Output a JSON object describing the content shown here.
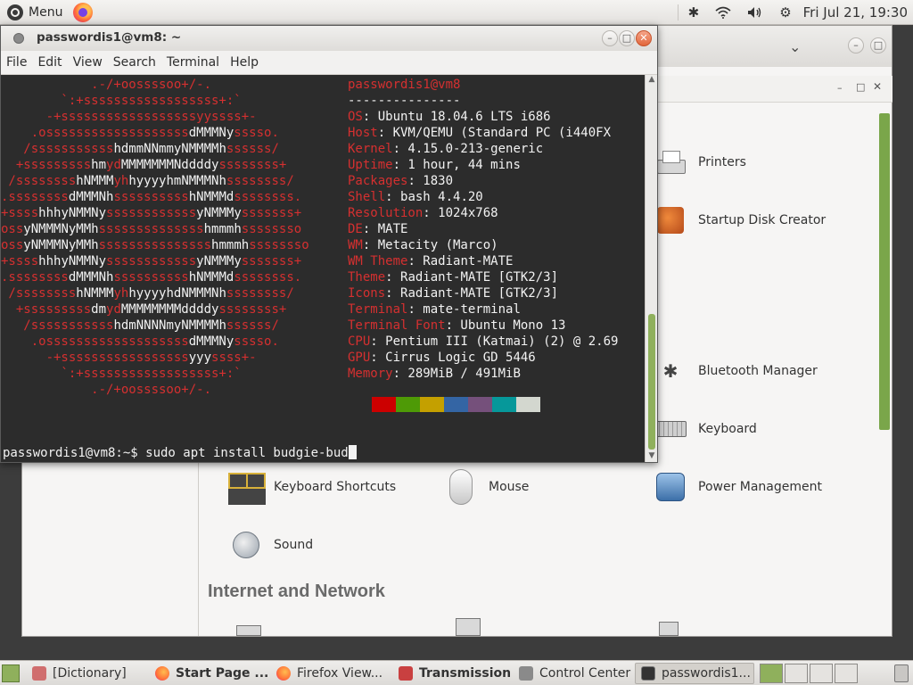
{
  "top_panel": {
    "menu_label": "Menu",
    "clock": "Fri Jul 21, 19:30",
    "tray_icons": [
      "bluetooth-icon",
      "wifi-icon",
      "volume-icon",
      "settings-icon"
    ]
  },
  "control_center": {
    "items": {
      "printers": "Printers",
      "startup_disk": "Startup Disk Creator",
      "bluetooth": "Bluetooth Manager",
      "keyboard": "Keyboard",
      "keyboard_shortcuts": "Keyboard Shortcuts",
      "mouse": "Mouse",
      "power": "Power Management",
      "sound": "Sound"
    },
    "section_internet": "Internet and Network"
  },
  "terminal": {
    "title": "passwordis1@vm8: ~",
    "menu": [
      "File",
      "Edit",
      "View",
      "Search",
      "Terminal",
      "Help"
    ],
    "info": {
      "user_host": "passwordis1@vm8",
      "rule": "---------------",
      "rows": [
        {
          "k": "OS",
          "v": ": Ubuntu 18.04.6 LTS i686"
        },
        {
          "k": "Host",
          "v": ": KVM/QEMU (Standard PC (i440FX"
        },
        {
          "k": "Kernel",
          "v": ": 4.15.0-213-generic"
        },
        {
          "k": "Uptime",
          "v": ": 1 hour, 44 mins"
        },
        {
          "k": "Packages",
          "v": ": 1830"
        },
        {
          "k": "Shell",
          "v": ": bash 4.4.20"
        },
        {
          "k": "Resolution",
          "v": ": 1024x768"
        },
        {
          "k": "DE",
          "v": ": MATE"
        },
        {
          "k": "WM",
          "v": ": Metacity (Marco)"
        },
        {
          "k": "WM Theme",
          "v": ": Radiant-MATE"
        },
        {
          "k": "Theme",
          "v": ": Radiant-MATE [GTK2/3]"
        },
        {
          "k": "Icons",
          "v": ": Radiant-MATE [GTK2/3]"
        },
        {
          "k": "Terminal",
          "v": ": mate-terminal"
        },
        {
          "k": "Terminal Font",
          "v": ": Ubuntu Mono 13"
        },
        {
          "k": "CPU",
          "v": ": Pentium III (Katmai) (2) @ 2.69"
        },
        {
          "k": "GPU",
          "v": ": Cirrus Logic GD 5446"
        },
        {
          "k": "Memory",
          "v": ": 289MiB / 491MiB"
        }
      ]
    },
    "logo": [
      [
        [
          "r",
          "            .-/+oossssoo+/-."
        ]
      ],
      [
        [
          "r",
          "        `:+ssssssssssssssssss+:`"
        ]
      ],
      [
        [
          "r",
          "      -+ssssssssssssssssssyyssss+-"
        ]
      ],
      [
        [
          "r",
          "    .osssssssssssssssssss"
        ],
        [
          "w",
          "dMMMNy"
        ],
        [
          "r",
          "sssso."
        ]
      ],
      [
        [
          "r",
          "   /sssssssssss"
        ],
        [
          "w",
          "hdmmNNmmyNMMMMh"
        ],
        [
          "r",
          "ssssss/"
        ]
      ],
      [
        [
          "r",
          "  +sssssssss"
        ],
        [
          "w",
          "hm"
        ],
        [
          "r",
          "yd"
        ],
        [
          "w",
          "MMMMMMMNddddy"
        ],
        [
          "r",
          "ssssssss+"
        ]
      ],
      [
        [
          "r",
          " /ssssssss"
        ],
        [
          "w",
          "hNMMM"
        ],
        [
          "r",
          "yh"
        ],
        [
          "w",
          "hyyyyhmNMMMNh"
        ],
        [
          "r",
          "ssssssss/"
        ]
      ],
      [
        [
          "r",
          ".ssssssss"
        ],
        [
          "w",
          "dMMMNh"
        ],
        [
          "r",
          "ssssssssss"
        ],
        [
          "w",
          "hNMMMd"
        ],
        [
          "r",
          "ssssssss."
        ]
      ],
      [
        [
          "r",
          "+ssss"
        ],
        [
          "w",
          "hhhyNMMNy"
        ],
        [
          "r",
          "ssssssssssss"
        ],
        [
          "w",
          "yNMMMy"
        ],
        [
          "r",
          "sssssss+"
        ]
      ],
      [
        [
          "r",
          "oss"
        ],
        [
          "w",
          "yNMMMNyMMh"
        ],
        [
          "r",
          "ssssssssssssss"
        ],
        [
          "w",
          "hmmmh"
        ],
        [
          "r",
          "ssssssso"
        ]
      ],
      [
        [
          "r",
          "oss"
        ],
        [
          "w",
          "yNMMMNyMMh"
        ],
        [
          "r",
          "sssssssssssssss"
        ],
        [
          "w",
          "hmmmh"
        ],
        [
          "r",
          "ssssssso"
        ]
      ],
      [
        [
          "r",
          "+ssss"
        ],
        [
          "w",
          "hhhyNMMNy"
        ],
        [
          "r",
          "ssssssssssss"
        ],
        [
          "w",
          "yNMMMy"
        ],
        [
          "r",
          "sssssss+"
        ]
      ],
      [
        [
          "r",
          ".ssssssss"
        ],
        [
          "w",
          "dMMMNh"
        ],
        [
          "r",
          "ssssssssss"
        ],
        [
          "w",
          "hNMMMd"
        ],
        [
          "r",
          "ssssssss."
        ]
      ],
      [
        [
          "r",
          " /ssssssss"
        ],
        [
          "w",
          "hNMMM"
        ],
        [
          "r",
          "yh"
        ],
        [
          "w",
          "hyyyyhdNMMMNh"
        ],
        [
          "r",
          "ssssssss/"
        ]
      ],
      [
        [
          "r",
          "  +sssssssss"
        ],
        [
          "w",
          "dm"
        ],
        [
          "r",
          "yd"
        ],
        [
          "w",
          "MMMMMMMMddddy"
        ],
        [
          "r",
          "ssssssss+"
        ]
      ],
      [
        [
          "r",
          "   /sssssssssss"
        ],
        [
          "w",
          "hdmNNNNmyNMMMMh"
        ],
        [
          "r",
          "ssssss/"
        ]
      ],
      [
        [
          "r",
          "    .osssssssssssssssssss"
        ],
        [
          "w",
          "dMMMNy"
        ],
        [
          "r",
          "sssso."
        ]
      ],
      [
        [
          "r",
          "      -+sssssssssssssssss"
        ],
        [
          "w",
          "yyy"
        ],
        [
          "r",
          "ssss+-"
        ]
      ],
      [
        [
          "r",
          "        `:+ssssssssssssssssss+:`"
        ]
      ],
      [
        [
          "r",
          "            .-/+oossssoo+/-."
        ]
      ]
    ],
    "swatch_colors": [
      "#2c2c2c",
      "#cc0000",
      "#4e9a06",
      "#c4a000",
      "#3465a4",
      "#75507b",
      "#06989a",
      "#d3d7cf"
    ],
    "prompt": "passwordis1@vm8:~$ sudo apt install budgie-bud"
  },
  "taskbar": {
    "tasks": [
      {
        "label": "[Dictionary]"
      },
      {
        "label": "Start Page ..."
      },
      {
        "label": "Firefox View..."
      },
      {
        "label": "Transmission"
      },
      {
        "label": "Control Center"
      },
      {
        "label": "passwordis1..."
      }
    ]
  }
}
